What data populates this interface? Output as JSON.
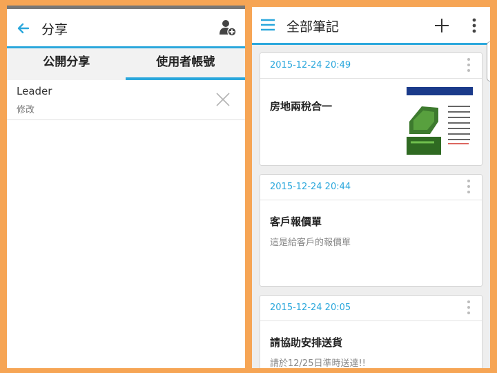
{
  "left": {
    "header": {
      "title": "分享",
      "back_icon": "arrow-left-icon",
      "add_icon": "add-user-icon"
    },
    "tabs": [
      {
        "label": "公開分享",
        "selected": false
      },
      {
        "label": "使用者帳號",
        "selected": true
      }
    ],
    "shares": [
      {
        "name": "Leader",
        "permission": "修改",
        "remove_icon": "close-icon"
      }
    ]
  },
  "right": {
    "header": {
      "title": "全部筆記",
      "menu_icon": "hamburger-menu-icon",
      "add_icon": "plus-icon",
      "more_icon": "more-vertical-icon"
    },
    "notes": [
      {
        "date": "2015-12-24 20:49",
        "title": "房地兩稅合一",
        "body": "",
        "has_thumbnail": true
      },
      {
        "date": "2015-12-24 20:44",
        "title": "客戶報價單",
        "body": "這是給客戶的報價單",
        "has_thumbnail": false
      },
      {
        "date": "2015-12-24 20:05",
        "title": "請協助安排送貨",
        "body": "請於12/25日準時送達!!",
        "has_thumbnail": false
      }
    ]
  },
  "colors": {
    "accent": "#2aa7dc",
    "frame": "#f6a555"
  }
}
